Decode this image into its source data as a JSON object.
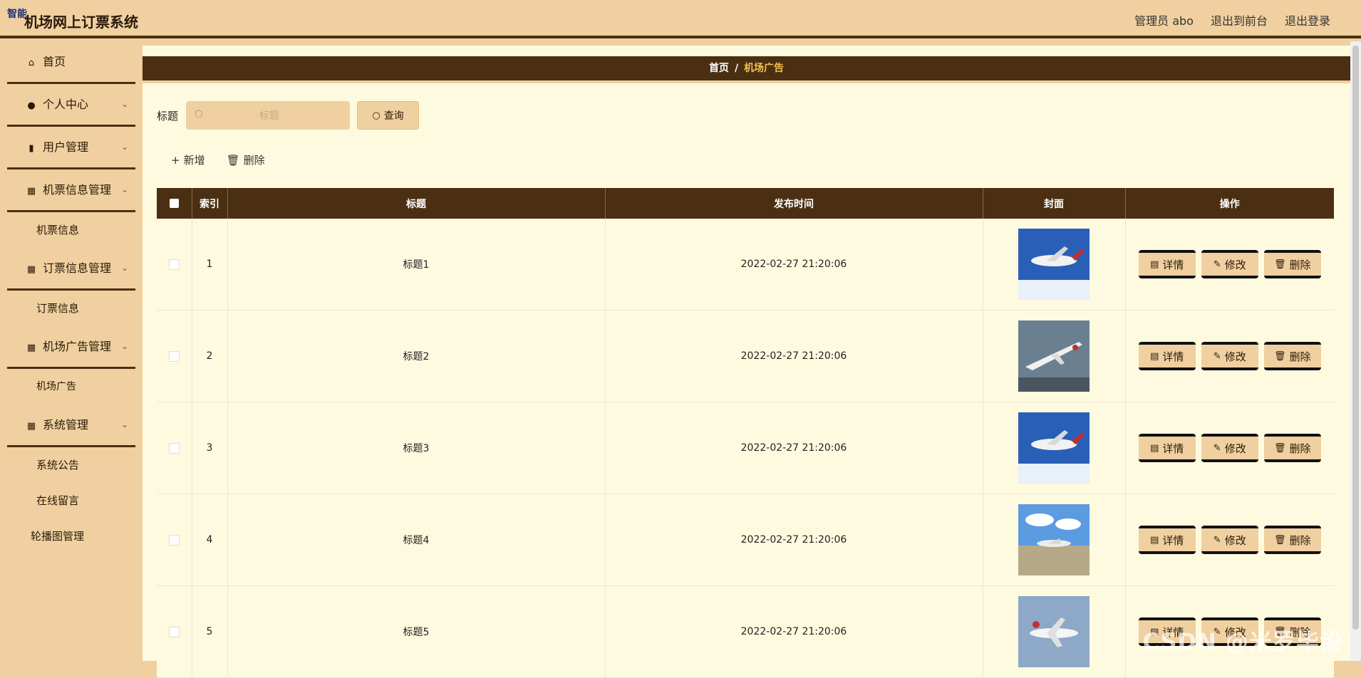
{
  "header": {
    "badge": "智能",
    "title": "机场网上订票系统",
    "user": "管理员 abo",
    "to_front": "退出到前台",
    "logout": "退出登录"
  },
  "sidebar": {
    "home": "首页",
    "personal": "个人中心",
    "users": "用户管理",
    "ticket_mgmt": "机票信息管理",
    "ticket_info": "机票信息",
    "booking_mgmt": "订票信息管理",
    "booking_info": "订票信息",
    "ad_mgmt": "机场广告管理",
    "ad": "机场广告",
    "system_mgmt": "系统管理",
    "notice": "系统公告",
    "message": "在线留言",
    "carousel": "轮播图管理"
  },
  "breadcrumb": {
    "home": "首页",
    "sep": "/",
    "current": "机场广告"
  },
  "search": {
    "label": "标题",
    "placeholder": "标题",
    "button": "查询"
  },
  "actions": {
    "add": "新增",
    "delete": "删除"
  },
  "table": {
    "columns": [
      "索引",
      "标题",
      "发布时间",
      "封面",
      "操作"
    ],
    "rows": [
      {
        "index": "1",
        "title": "标题1",
        "time": "2022-02-27 21:20:06",
        "cover": "plane-blue-sky"
      },
      {
        "index": "2",
        "title": "标题2",
        "time": "2022-02-27 21:20:06",
        "cover": "plane-takeoff-grey"
      },
      {
        "index": "3",
        "title": "标题3",
        "time": "2022-02-27 21:20:06",
        "cover": "plane-blue-sky"
      },
      {
        "index": "4",
        "title": "标题4",
        "time": "2022-02-27 21:20:06",
        "cover": "plane-runway"
      },
      {
        "index": "5",
        "title": "标题5",
        "time": "2022-02-27 21:20:06",
        "cover": "plane-white-sky"
      }
    ],
    "op_labels": {
      "detail": "详情",
      "edit": "修改",
      "delete": "删除"
    }
  },
  "watermark": "CSDN @米罗毕设",
  "colors": {
    "accent": "#f0d0a0",
    "dark": "#4a2f12",
    "content_bg": "#fefadf",
    "breadcrumb_current": "#f5c050"
  }
}
